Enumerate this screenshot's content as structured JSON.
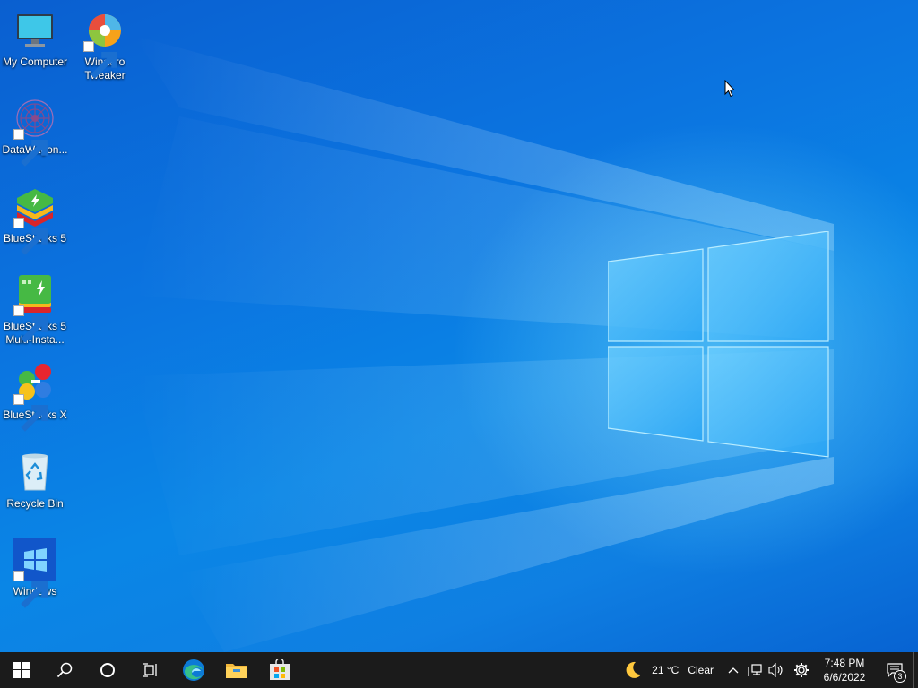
{
  "desktop": {
    "icons": [
      {
        "label": "My Computer",
        "icon": "monitor-icon",
        "shortcut": false
      },
      {
        "label": "Winaero Tweaker",
        "icon": "winaero-tweaker-icon",
        "shortcut": true
      },
      {
        "label": "DataWagon...",
        "icon": "datawagon-icon",
        "shortcut": true
      },
      {
        "label": "BlueStacks 5",
        "icon": "bluestacks-icon",
        "shortcut": true
      },
      {
        "label": "BlueStacks 5 Multi-Insta...",
        "icon": "bluestacks-multi-instance-icon",
        "shortcut": true
      },
      {
        "label": "BlueStacks X",
        "icon": "bluestacks-x-icon",
        "shortcut": true
      },
      {
        "label": "Recycle Bin",
        "icon": "recycle-bin-icon",
        "shortcut": false
      },
      {
        "label": "Windows",
        "icon": "windows-logo-icon",
        "shortcut": true
      }
    ]
  },
  "taskbar": {
    "pinned": [
      "start-icon",
      "search-icon",
      "cortana-icon",
      "task-view-icon",
      "edge-icon",
      "file-explorer-icon",
      "store-icon"
    ],
    "weather": {
      "icon": "moon-icon",
      "temperature": "21 °C",
      "condition": "Clear"
    },
    "clock": {
      "time": "7:48 PM",
      "date": "6/6/2022"
    },
    "notifications": {
      "count": "3"
    }
  },
  "colors": {
    "taskbar": "#1b1b1b",
    "desktop_blue": "#0b74e0",
    "edge_blue": "#0c7ad6"
  }
}
